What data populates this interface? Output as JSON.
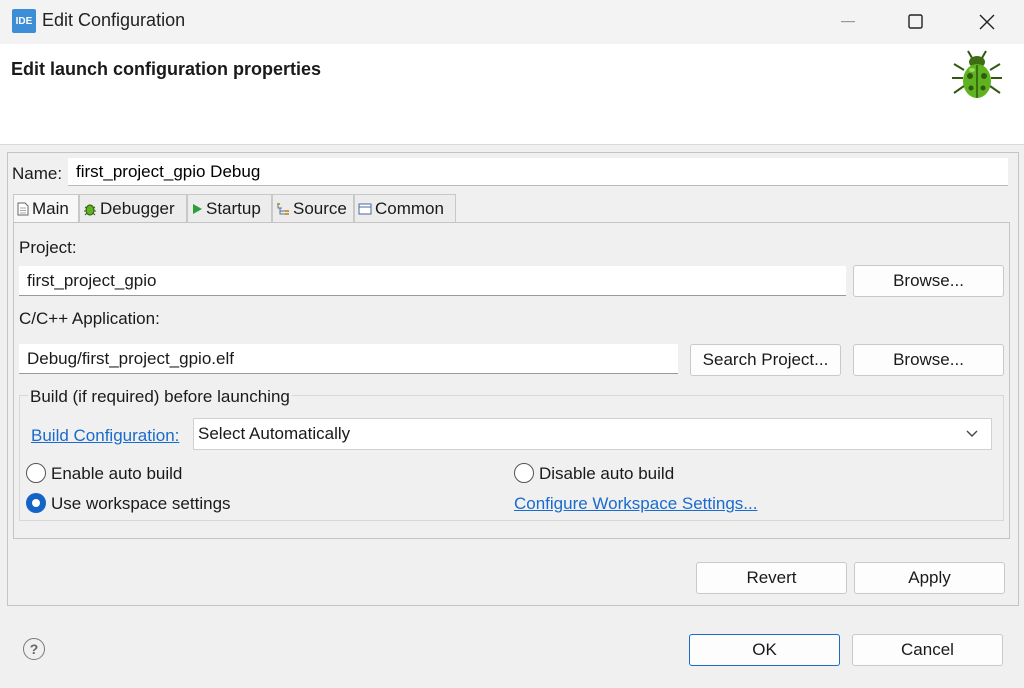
{
  "window": {
    "app_icon_text": "IDE",
    "title": "Edit Configuration",
    "minimize": "—",
    "maximize": "☐",
    "close": "✕"
  },
  "banner": {
    "title": "Edit launch configuration properties",
    "icon": "bug-icon"
  },
  "name": {
    "label": "Name:",
    "value": "first_project_gpio Debug"
  },
  "tabs": [
    {
      "label": "Main",
      "icon": "document-icon",
      "active": true
    },
    {
      "label": "Debugger",
      "icon": "bug-icon",
      "active": false
    },
    {
      "label": "Startup",
      "icon": "play-icon",
      "active": false
    },
    {
      "label": "Source",
      "icon": "source-icon",
      "active": false
    },
    {
      "label": "Common",
      "icon": "table-icon",
      "active": false
    }
  ],
  "main": {
    "project_label": "Project:",
    "project_value": "first_project_gpio",
    "project_browse": "Browse...",
    "app_label": "C/C++ Application:",
    "app_value": "Debug/first_project_gpio.elf",
    "search_project": "Search Project...",
    "app_browse": "Browse..."
  },
  "build": {
    "group_label": "Build (if required) before launching",
    "config_link": "Build Configuration:",
    "config_value": "Select Automatically",
    "enable_auto": "Enable auto build",
    "disable_auto": "Disable auto build",
    "use_workspace": "Use workspace settings",
    "configure_link": "Configure Workspace Settings...",
    "selected": "use_workspace"
  },
  "actions": {
    "revert": "Revert",
    "apply": "Apply",
    "ok": "OK",
    "cancel": "Cancel",
    "help": "?"
  },
  "colors": {
    "accent": "#1464c8",
    "link": "#1a6bcc",
    "ok_border": "#1a6bcc"
  }
}
